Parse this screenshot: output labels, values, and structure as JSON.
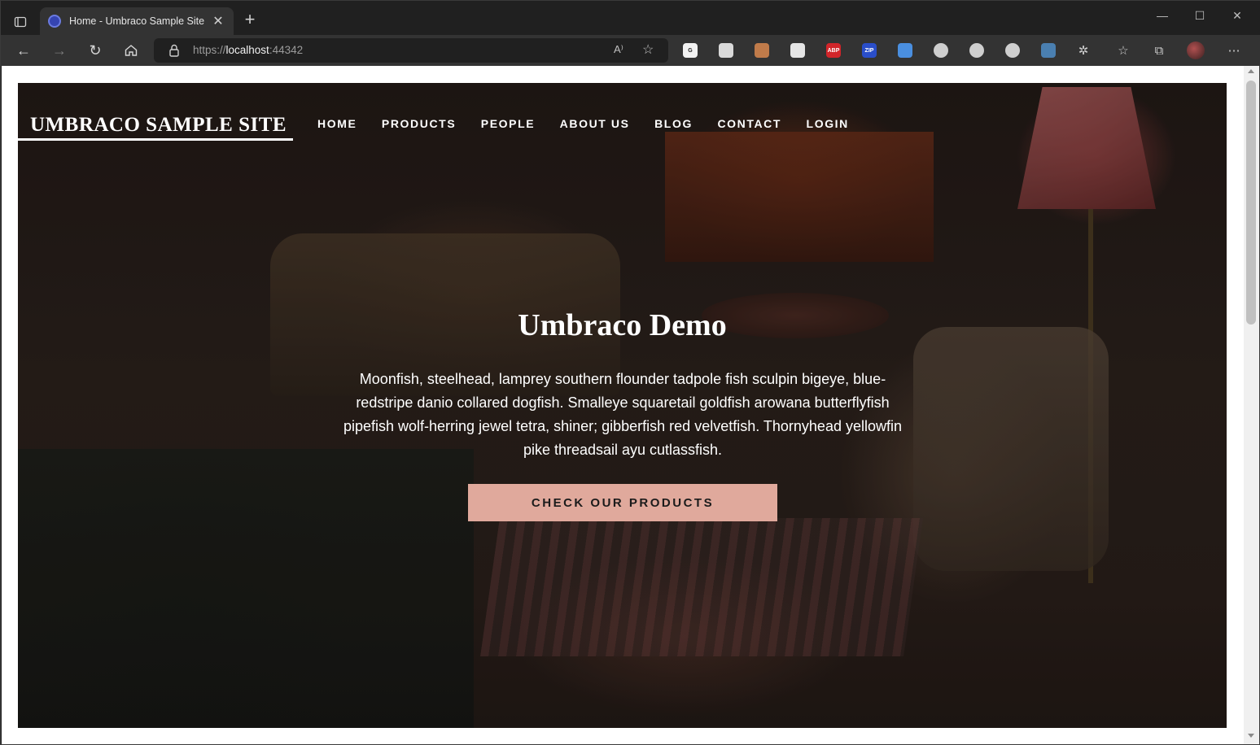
{
  "browser": {
    "tab_title": "Home - Umbraco Sample Site",
    "tab_close": "✕",
    "new_tab": "+",
    "url_scheme": "https://",
    "url_host": "localhost",
    "url_port": ":44342",
    "read_aloud": "A⁾",
    "window_controls": [
      "—",
      "☐",
      "✕"
    ],
    "extensions": [
      {
        "name": "grammar-extension-icon",
        "label": "G",
        "color": "#f2f2f2"
      },
      {
        "name": "notes-extension-icon",
        "label": "",
        "color": "#d9d9d9"
      },
      {
        "name": "cookie-extension-icon",
        "label": "",
        "color": "#c07b4a"
      },
      {
        "name": "eraser-extension-icon",
        "label": "",
        "color": "#e5e5e5"
      },
      {
        "name": "adblock-extension-icon",
        "label": "ABP",
        "color": "#d2252a"
      },
      {
        "name": "zip-extension-icon",
        "label": "ZIP",
        "color": "#2a4ec9"
      },
      {
        "name": "calendar-extension-icon",
        "label": "",
        "color": "#4a8fe0"
      },
      {
        "name": "target-extension-icon",
        "label": "",
        "color": "#cfcfcf"
      },
      {
        "name": "soccer-extension-icon",
        "label": "",
        "color": "#cfcfcf"
      },
      {
        "name": "react-extension-icon",
        "label": "",
        "color": "#cfcfcf"
      },
      {
        "name": "globe-extension-icon",
        "label": "",
        "color": "#4a7fb0"
      }
    ]
  },
  "site": {
    "brand": "UMBRACO SAMPLE SITE",
    "nav": [
      "HOME",
      "PRODUCTS",
      "PEOPLE",
      "ABOUT US",
      "BLOG",
      "CONTACT",
      "LOGIN"
    ],
    "hero": {
      "title": "Umbraco Demo",
      "text": "Moonfish, steelhead, lamprey southern flounder tadpole fish sculpin bigeye, blue-redstripe danio collared dogfish. Smalleye squaretail goldfish arowana butterflyfish pipefish wolf-herring jewel tetra, shiner; gibberfish red velvetfish. Thornyhead yellowfin pike threadsail ayu cutlassfish.",
      "cta": "CHECK OUR PRODUCTS"
    }
  },
  "colors": {
    "cta_background": "#e0a99c",
    "browser_chrome": "#333333"
  }
}
